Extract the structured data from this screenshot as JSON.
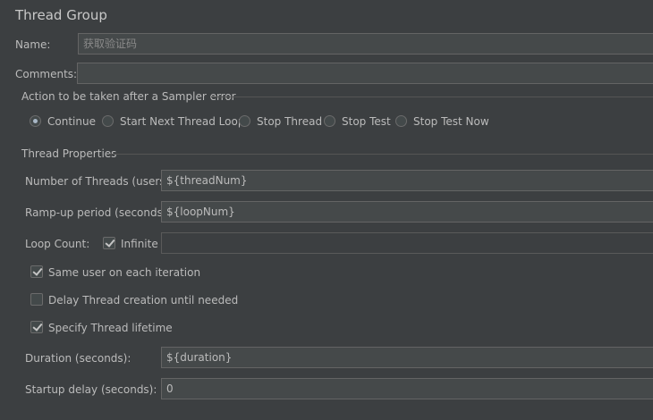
{
  "panel": {
    "title": "Thread Group",
    "name_label": "Name:",
    "name_value": "获取验证码",
    "comments_label": "Comments:",
    "comments_value": ""
  },
  "sampler_error": {
    "title": "Action to be taken after a Sampler error",
    "options": [
      {
        "label": "Continue",
        "selected": true
      },
      {
        "label": "Start Next Thread Loop",
        "selected": false
      },
      {
        "label": "Stop Thread",
        "selected": false
      },
      {
        "label": "Stop Test",
        "selected": false
      },
      {
        "label": "Stop Test Now",
        "selected": false
      }
    ]
  },
  "thread_properties": {
    "title": "Thread Properties",
    "num_threads_label": "Number of Threads (users):",
    "num_threads_value": "${threadNum}",
    "ramp_up_label": "Ramp-up period (seconds):",
    "ramp_up_value": "${loopNum}",
    "loop_count_label": "Loop Count:",
    "infinite_label": "Infinite",
    "infinite_checked": true,
    "loop_count_value": "",
    "same_user_label": "Same user on each iteration",
    "same_user_checked": true,
    "delay_creation_label": "Delay Thread creation until needed",
    "delay_creation_checked": false,
    "specify_lifetime_label": "Specify Thread lifetime",
    "specify_lifetime_checked": true,
    "duration_label": "Duration (seconds):",
    "duration_value": "${duration}",
    "startup_delay_label": "Startup delay (seconds):",
    "startup_delay_value": "0"
  }
}
